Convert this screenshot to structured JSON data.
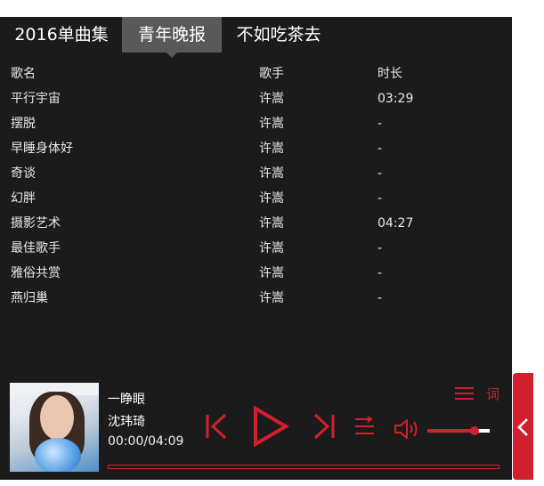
{
  "tabs": [
    {
      "label": "2016单曲集",
      "active": false
    },
    {
      "label": "青年晚报",
      "active": true
    },
    {
      "label": "不如吃茶去",
      "active": false
    }
  ],
  "table": {
    "headers": {
      "name": "歌名",
      "artist": "歌手",
      "duration": "时长"
    },
    "rows": [
      {
        "name": "平行宇宙",
        "artist": "许嵩",
        "duration": "03:29"
      },
      {
        "name": "摆脱",
        "artist": "许嵩",
        "duration": "-"
      },
      {
        "name": "早睡身体好",
        "artist": "许嵩",
        "duration": "-"
      },
      {
        "name": "奇谈",
        "artist": "许嵩",
        "duration": "-"
      },
      {
        "name": "幻胖",
        "artist": "许嵩",
        "duration": "-"
      },
      {
        "name": "摄影艺术",
        "artist": "许嵩",
        "duration": "04:27"
      },
      {
        "name": "最佳歌手",
        "artist": "许嵩",
        "duration": "-"
      },
      {
        "name": "雅俗共赏",
        "artist": "许嵩",
        "duration": "-"
      },
      {
        "name": "燕归巢",
        "artist": "许嵩",
        "duration": "-"
      }
    ]
  },
  "now_playing": {
    "title": "一睁眼",
    "artist": "沈玮琦",
    "time": "00:00/04:09",
    "progress": 0
  },
  "volume": {
    "level": 0.75
  },
  "lyrics_label": "词",
  "icons": {
    "prev": "skip-previous-icon",
    "play": "play-icon",
    "next": "skip-next-icon",
    "mode": "play-mode-icon",
    "volume": "volume-icon",
    "playlist": "playlist-icon",
    "collapse": "chevron-left-icon"
  },
  "colors": {
    "accent": "#d1202d",
    "panel": "#1c1b1c",
    "tab_active": "#5a595a"
  }
}
